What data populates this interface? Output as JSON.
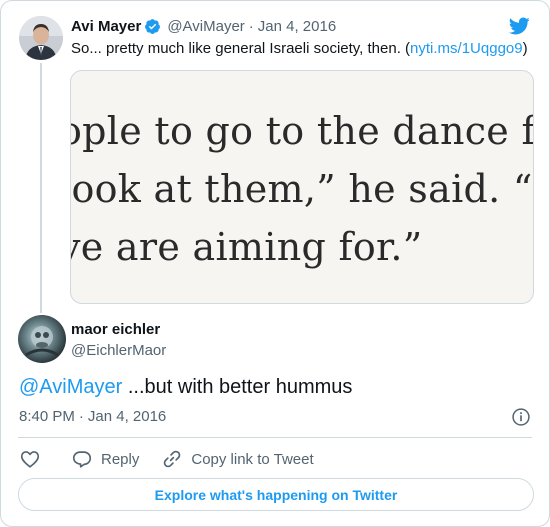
{
  "parent_tweet": {
    "author_name": "Avi Mayer",
    "handle": "@AviMayer",
    "separator": "·",
    "date": "Jan 4, 2016",
    "text": "So... pretty much like general Israeli society, then. (",
    "link_text": "nyti.ms/1Uqggo9",
    "text_end": ")",
    "image_text_lines": [
      "ople to go to the dance floor",
      "look at them,” he said. “Th",
      "ve are aiming for.”"
    ]
  },
  "reply_tweet": {
    "author_name": "maor eichler",
    "handle": "@EichlerMaor",
    "mention": "@AviMayer",
    "text": " ...but with better hummus",
    "time": "8:40 PM",
    "separator": "·",
    "date": "Jan 4, 2016"
  },
  "actions": {
    "reply_label": "Reply",
    "copy_link_label": "Copy link to Tweet"
  },
  "explore_button_label": "Explore what's happening on Twitter",
  "icons": [
    "verified-badge-icon",
    "twitter-bird-icon",
    "info-icon",
    "heart-icon",
    "reply-icon",
    "link-icon"
  ],
  "colors": {
    "accent": "#1d9bf0",
    "text": "#0f1419",
    "secondary_text": "#536471",
    "border": "#cfd9de"
  }
}
